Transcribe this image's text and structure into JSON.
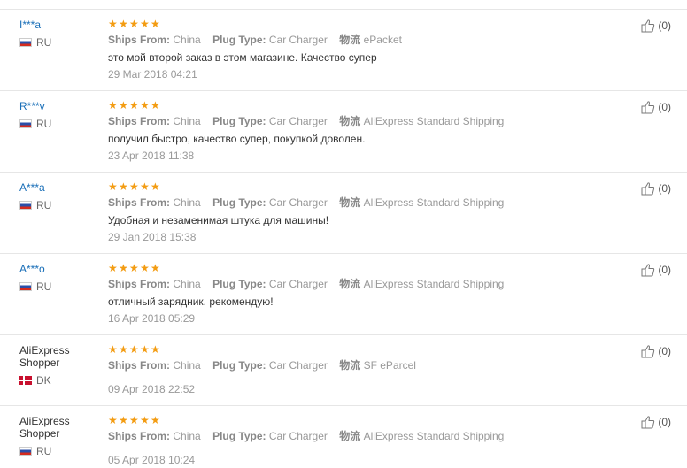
{
  "labels": {
    "ships_from": "Ships From:",
    "plug_type": "Plug Type:",
    "logistics": "物流"
  },
  "reviews": [
    {
      "user": "I***a",
      "country": "RU",
      "flag": "ru",
      "ships_from": "China",
      "plug_type": "Car Charger",
      "logistics": "ePacket",
      "feedback": "это мой второй заказ в этом магазине. Качество супер",
      "date": "29 Mar 2018 04:21",
      "helpful": "(0)",
      "rating": 5
    },
    {
      "user": "R***v",
      "country": "RU",
      "flag": "ru",
      "ships_from": "China",
      "plug_type": "Car Charger",
      "logistics": "AliExpress Standard Shipping",
      "feedback": "получил быстро, качество супер, покупкой доволен.",
      "date": "23 Apr 2018 11:38",
      "helpful": "(0)",
      "rating": 5
    },
    {
      "user": "A***a",
      "country": "RU",
      "flag": "ru",
      "ships_from": "China",
      "plug_type": "Car Charger",
      "logistics": "AliExpress Standard Shipping",
      "feedback": "Удобная и незаменимая штука для машины!",
      "date": "29 Jan 2018 15:38",
      "helpful": "(0)",
      "rating": 5
    },
    {
      "user": "A***o",
      "country": "RU",
      "flag": "ru",
      "ships_from": "China",
      "plug_type": "Car Charger",
      "logistics": "AliExpress Standard Shipping",
      "feedback": "отличный зарядник. рекомендую!",
      "date": "16 Apr 2018 05:29",
      "helpful": "(0)",
      "rating": 5
    },
    {
      "user": "AliExpress Shopper",
      "country": "DK",
      "flag": "dk",
      "ships_from": "China",
      "plug_type": "Car Charger",
      "logistics": "SF eParcel",
      "feedback": "",
      "date": "09 Apr 2018 22:52",
      "helpful": "(0)",
      "rating": 5
    },
    {
      "user": "AliExpress Shopper",
      "country": "RU",
      "flag": "ru",
      "ships_from": "China",
      "plug_type": "Car Charger",
      "logistics": "AliExpress Standard Shipping",
      "feedback": "",
      "date": "05 Apr 2018 10:24",
      "helpful": "(0)",
      "rating": 5
    }
  ]
}
